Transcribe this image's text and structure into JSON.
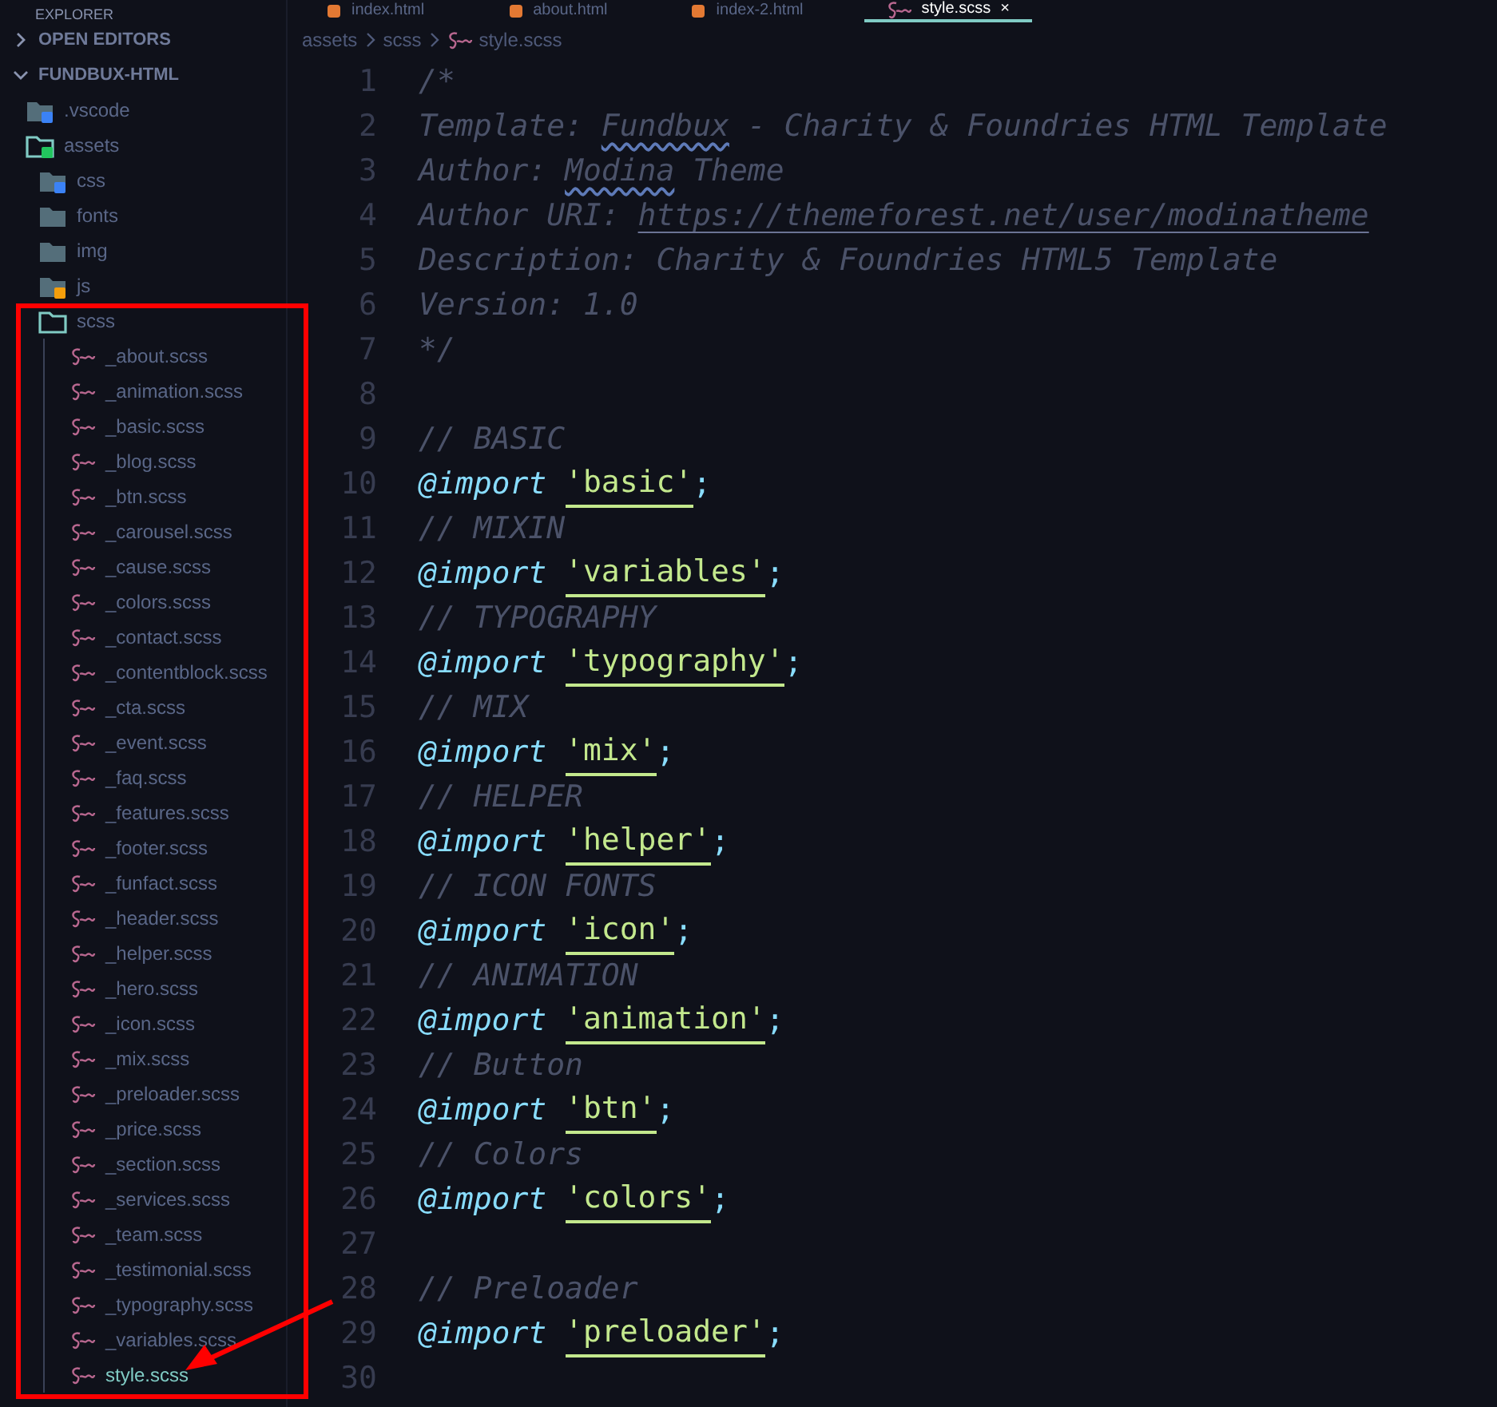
{
  "explorer": {
    "title": "EXPLORER",
    "sections": [
      {
        "label": "OPEN EDITORS",
        "expanded": false
      },
      {
        "label": "FUNDBUX-HTML",
        "expanded": true
      }
    ],
    "tree": [
      {
        "name": ".vscode",
        "kind": "vscode-folder"
      },
      {
        "name": "assets",
        "kind": "assets-folder",
        "expanded": true,
        "children": [
          {
            "name": "css",
            "kind": "css-folder"
          },
          {
            "name": "fonts",
            "kind": "folder"
          },
          {
            "name": "img",
            "kind": "folder"
          },
          {
            "name": "js",
            "kind": "js-folder"
          },
          {
            "name": "scss",
            "kind": "folder",
            "expanded": true,
            "children": [
              {
                "name": "_about.scss",
                "kind": "sass-file",
                "selected": false
              },
              {
                "name": "_animation.scss",
                "kind": "sass-file",
                "selected": false
              },
              {
                "name": "_basic.scss",
                "kind": "sass-file",
                "selected": false
              },
              {
                "name": "_blog.scss",
                "kind": "sass-file",
                "selected": false
              },
              {
                "name": "_btn.scss",
                "kind": "sass-file",
                "selected": false
              },
              {
                "name": "_carousel.scss",
                "kind": "sass-file",
                "selected": false
              },
              {
                "name": "_cause.scss",
                "kind": "sass-file",
                "selected": false
              },
              {
                "name": "_colors.scss",
                "kind": "sass-file",
                "selected": false
              },
              {
                "name": "_contact.scss",
                "kind": "sass-file",
                "selected": false
              },
              {
                "name": "_contentblock.scss",
                "kind": "sass-file",
                "selected": false
              },
              {
                "name": "_cta.scss",
                "kind": "sass-file",
                "selected": false
              },
              {
                "name": "_event.scss",
                "kind": "sass-file",
                "selected": false
              },
              {
                "name": "_faq.scss",
                "kind": "sass-file",
                "selected": false
              },
              {
                "name": "_features.scss",
                "kind": "sass-file",
                "selected": false
              },
              {
                "name": "_footer.scss",
                "kind": "sass-file",
                "selected": false
              },
              {
                "name": "_funfact.scss",
                "kind": "sass-file",
                "selected": false
              },
              {
                "name": "_header.scss",
                "kind": "sass-file",
                "selected": false
              },
              {
                "name": "_helper.scss",
                "kind": "sass-file",
                "selected": false
              },
              {
                "name": "_hero.scss",
                "kind": "sass-file",
                "selected": false
              },
              {
                "name": "_icon.scss",
                "kind": "sass-file",
                "selected": false
              },
              {
                "name": "_mix.scss",
                "kind": "sass-file",
                "selected": false
              },
              {
                "name": "_preloader.scss",
                "kind": "sass-file",
                "selected": false
              },
              {
                "name": "_price.scss",
                "kind": "sass-file",
                "selected": false
              },
              {
                "name": "_section.scss",
                "kind": "sass-file",
                "selected": false
              },
              {
                "name": "_services.scss",
                "kind": "sass-file",
                "selected": false
              },
              {
                "name": "_team.scss",
                "kind": "sass-file",
                "selected": false
              },
              {
                "name": "_testimonial.scss",
                "kind": "sass-file",
                "selected": false
              },
              {
                "name": "_typography.scss",
                "kind": "sass-file",
                "selected": false
              },
              {
                "name": "_variables.scss",
                "kind": "sass-file",
                "selected": false
              },
              {
                "name": "style.scss",
                "kind": "sass-file",
                "selected": true
              }
            ]
          }
        ]
      }
    ]
  },
  "tabs": [
    {
      "label": "index.html",
      "kind": "html",
      "selected": false
    },
    {
      "label": "about.html",
      "kind": "html",
      "selected": false
    },
    {
      "label": "index-2.html",
      "kind": "html",
      "selected": false
    },
    {
      "label": "style.scss",
      "kind": "sass",
      "selected": true,
      "close": "×"
    }
  ],
  "breadcrumbs": [
    "assets",
    "scss",
    "style.scss"
  ],
  "lines": [
    {
      "number": "1",
      "kind": "comment",
      "parts": [
        {
          "text": "/*",
          "kind": "plain"
        }
      ]
    },
    {
      "number": "2",
      "kind": "comment",
      "parts": [
        {
          "text": "Template: ",
          "kind": "plain"
        },
        {
          "text": "Fundbux",
          "kind": "spell"
        },
        {
          "text": " - Charity & Foundries HTML Template",
          "kind": "plain"
        }
      ]
    },
    {
      "number": "3",
      "kind": "comment",
      "parts": [
        {
          "text": "Author: ",
          "kind": "plain"
        },
        {
          "text": "Modina",
          "kind": "spell"
        },
        {
          "text": " Theme",
          "kind": "plain"
        }
      ]
    },
    {
      "number": "4",
      "kind": "comment",
      "parts": [
        {
          "text": "Author URI: ",
          "kind": "plain"
        },
        {
          "text": "https://themeforest.net/user/modinatheme",
          "kind": "link"
        }
      ]
    },
    {
      "number": "5",
      "kind": "comment",
      "parts": [
        {
          "text": "Description: Charity & Foundries HTML5 Template",
          "kind": "plain"
        }
      ]
    },
    {
      "number": "6",
      "kind": "comment",
      "parts": [
        {
          "text": "Version: 1.0",
          "kind": "plain"
        }
      ]
    },
    {
      "number": "7",
      "kind": "comment",
      "parts": [
        {
          "text": "*/",
          "kind": "plain"
        }
      ]
    },
    {
      "number": "8",
      "kind": "blank"
    },
    {
      "number": "9",
      "kind": "comment",
      "parts": [
        {
          "text": "// BASIC",
          "kind": "plain"
        }
      ]
    },
    {
      "number": "10",
      "kind": "import",
      "keyword": "@import",
      "value": "'basic'",
      "end": ";"
    },
    {
      "number": "11",
      "kind": "comment",
      "parts": [
        {
          "text": "// MIXIN",
          "kind": "plain"
        }
      ]
    },
    {
      "number": "12",
      "kind": "import",
      "keyword": "@import",
      "value": "'variables'",
      "end": ";"
    },
    {
      "number": "13",
      "kind": "comment",
      "parts": [
        {
          "text": "// TYPOGRAPHY",
          "kind": "plain"
        }
      ]
    },
    {
      "number": "14",
      "kind": "import",
      "keyword": "@import",
      "value": "'typography'",
      "end": ";"
    },
    {
      "number": "15",
      "kind": "comment",
      "parts": [
        {
          "text": "// MIX",
          "kind": "plain"
        }
      ]
    },
    {
      "number": "16",
      "kind": "import",
      "keyword": "@import",
      "value": "'mix'",
      "end": ";"
    },
    {
      "number": "17",
      "kind": "comment",
      "parts": [
        {
          "text": "// HELPER",
          "kind": "plain"
        }
      ]
    },
    {
      "number": "18",
      "kind": "import",
      "keyword": "@import",
      "value": "'helper'",
      "end": ";"
    },
    {
      "number": "19",
      "kind": "comment",
      "parts": [
        {
          "text": "// ICON FONTS",
          "kind": "plain"
        }
      ]
    },
    {
      "number": "20",
      "kind": "import",
      "keyword": "@import",
      "value": "'icon'",
      "end": ";"
    },
    {
      "number": "21",
      "kind": "comment",
      "parts": [
        {
          "text": "// ANIMATION",
          "kind": "plain"
        }
      ]
    },
    {
      "number": "22",
      "kind": "import",
      "keyword": "@import",
      "value": "'animation'",
      "end": ";"
    },
    {
      "number": "23",
      "kind": "comment",
      "parts": [
        {
          "text": "// Button",
          "kind": "plain"
        }
      ]
    },
    {
      "number": "24",
      "kind": "import",
      "keyword": "@import",
      "value": "'btn'",
      "end": ";"
    },
    {
      "number": "25",
      "kind": "comment",
      "parts": [
        {
          "text": "// Colors",
          "kind": "plain"
        }
      ]
    },
    {
      "number": "26",
      "kind": "import",
      "keyword": "@import",
      "value": "'colors'",
      "end": ";"
    },
    {
      "number": "27",
      "kind": "blank"
    },
    {
      "number": "28",
      "kind": "comment",
      "parts": [
        {
          "text": "// Preloader",
          "kind": "plain"
        }
      ]
    },
    {
      "number": "29",
      "kind": "import",
      "keyword": "@import",
      "value": "'preloader'",
      "end": ";"
    },
    {
      "number": "30",
      "kind": "blank"
    }
  ]
}
